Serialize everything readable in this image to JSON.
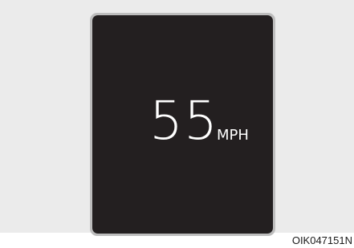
{
  "display": {
    "speed_value": "55",
    "speed_unit": "MPH"
  },
  "figure_code": "OIK047151N",
  "colors": {
    "backdrop": "#ebebeb",
    "frame": "#bdbdbd",
    "screen": "#231f20",
    "text": "#ffffff"
  }
}
